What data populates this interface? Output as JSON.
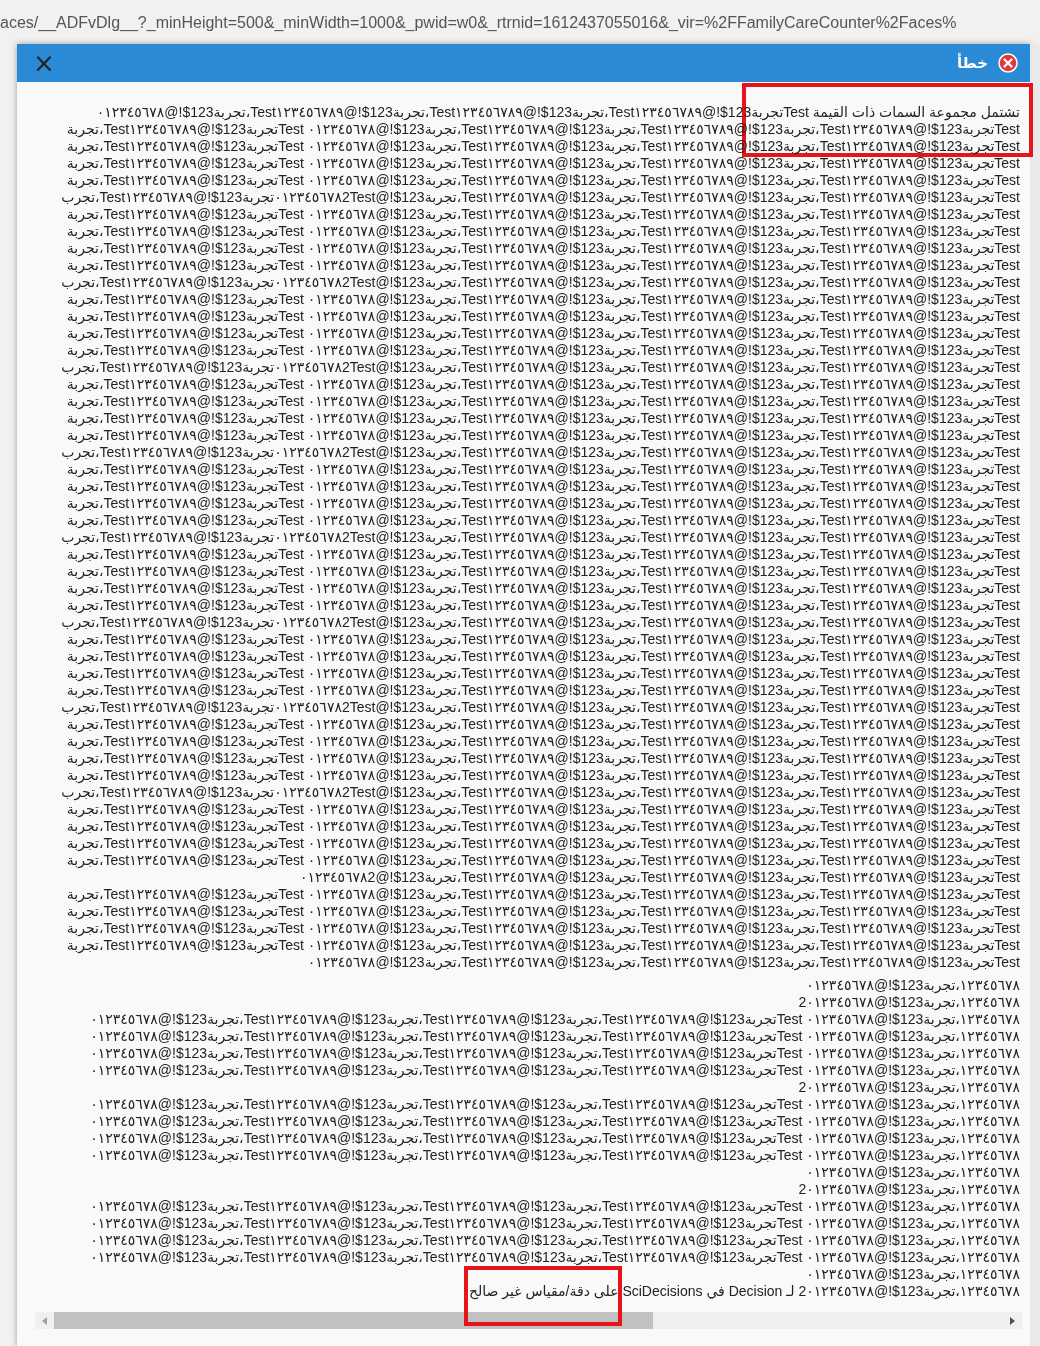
{
  "browser": {
    "address": "aces/__ADFvDlg__?_minHeight=500&_minWidth=1000&_pwid=w0&_rtrnid=1612437055016&_vir=%2FFamilyCareCounter%2Faces%"
  },
  "dialog": {
    "title": "خطأ",
    "close": "×",
    "message": {
      "lines": [
        "تشتمل مجموعة السمات ذات القيمة Testتجربة123$!@Test١٢٣٤٥٦٧٨٩،تجربة123$!@Test١٢٣٤٥٦٧٨٩،تجربة123$!@Test١٢٣٤٥٦٧٨٩،تجربة123$!@٠١٢٣٤٥٦٧٨",
        "Testتجربة123$!@Test١٢٣٤٥٦٧٨٩،تجربة123$!@Test١٢٣٤٥٦٧٨٩،تجربة123$!@Test١٢٣٤٥٦٧٨٩،تجربة123$!@٠١٢٣٤٥٦٧٨ Testتجربة123$!@Test١٢٣٤٥٦٧٨٩،تجربة",
        "Testتجربة123$!@Test١٢٣٤٥٦٧٨٩،تجربة123$!@Test١٢٣٤٥٦٧٨٩،تجربة123$!@Test١٢٣٤٥٦٧٨٩،تجربة123$!@٠١٢٣٤٥٦٧٨ Testتجربة123$!@Test١٢٣٤٥٦٧٨٩،تجربة",
        "Testتجربة123$!@Test١٢٣٤٥٦٧٨٩،تجربة123$!@Test١٢٣٤٥٦٧٨٩،تجربة123$!@Test١٢٣٤٥٦٧٨٩،تجربة123$!@٠١٢٣٤٥٦٧٨ Testتجربة123$!@Test١٢٣٤٥٦٧٨٩،تجربة",
        "Testتجربة123$!@Test١٢٣٤٥٦٧٨٩،تجربة123$!@Test١٢٣٤٥٦٧٨٩،تجربة123$!@Test١٢٣٤٥٦٧٨٩،تجربة123$!@٠١٢٣٤٥٦٧٨ Testتجربة123$!@Test١٢٣٤٥٦٧٨٩،تجربة",
        "Testتجربة123$!@Test١٢٣٤٥٦٧٨٩،تجربة123$!@Test١٢٣٤٥٦٧٨٩،تجربة123$!@Test١٢٣٤٥٦٧٨٩،تجربة123$!@٠١٢٣٤٥٦٧٨2Testتجربة123$!@Test١٢٣٤٥٦٧٨٩،تجرب",
        "Testتجربة123$!@Test١٢٣٤٥٦٧٨٩،تجربة123$!@Test١٢٣٤٥٦٧٨٩،تجربة123$!@Test١٢٣٤٥٦٧٨٩،تجربة123$!@٠١٢٣٤٥٦٧٨ Testتجربة123$!@Test١٢٣٤٥٦٧٨٩،تجربة",
        "Testتجربة123$!@Test١٢٣٤٥٦٧٨٩،تجربة123$!@Test١٢٣٤٥٦٧٨٩،تجربة123$!@Test١٢٣٤٥٦٧٨٩،تجربة123$!@٠١٢٣٤٥٦٧٨ Testتجربة123$!@Test١٢٣٤٥٦٧٨٩،تجربة",
        "Testتجربة123$!@Test١٢٣٤٥٦٧٨٩،تجربة123$!@Test١٢٣٤٥٦٧٨٩،تجربة123$!@Test١٢٣٤٥٦٧٨٩،تجربة123$!@٠١٢٣٤٥٦٧٨ Testتجربة123$!@Test١٢٣٤٥٦٧٨٩،تجربة",
        "Testتجربة123$!@Test١٢٣٤٥٦٧٨٩،تجربة123$!@Test١٢٣٤٥٦٧٨٩،تجربة123$!@Test١٢٣٤٥٦٧٨٩،تجربة123$!@٠١٢٣٤٥٦٧٨ Testتجربة123$!@Test١٢٣٤٥٦٧٨٩،تجربة",
        "Testتجربة123$!@Test١٢٣٤٥٦٧٨٩،تجربة123$!@Test١٢٣٤٥٦٧٨٩،تجربة123$!@Test١٢٣٤٥٦٧٨٩،تجربة123$!@٠١٢٣٤٥٦٧٨2Testتجربة123$!@Test١٢٣٤٥٦٧٨٩،تجرب",
        "Testتجربة123$!@Test١٢٣٤٥٦٧٨٩،تجربة123$!@Test١٢٣٤٥٦٧٨٩،تجربة123$!@Test١٢٣٤٥٦٧٨٩،تجربة123$!@٠١٢٣٤٥٦٧٨ Testتجربة123$!@Test١٢٣٤٥٦٧٨٩،تجربة",
        "Testتجربة123$!@Test١٢٣٤٥٦٧٨٩،تجربة123$!@Test١٢٣٤٥٦٧٨٩،تجربة123$!@Test١٢٣٤٥٦٧٨٩،تجربة123$!@٠١٢٣٤٥٦٧٨ Testتجربة123$!@Test١٢٣٤٥٦٧٨٩،تجربة",
        "Testتجربة123$!@Test١٢٣٤٥٦٧٨٩،تجربة123$!@Test١٢٣٤٥٦٧٨٩،تجربة123$!@Test١٢٣٤٥٦٧٨٩،تجربة123$!@٠١٢٣٤٥٦٧٨ Testتجربة123$!@Test١٢٣٤٥٦٧٨٩،تجربة",
        "Testتجربة123$!@Test١٢٣٤٥٦٧٨٩،تجربة123$!@Test١٢٣٤٥٦٧٨٩،تجربة123$!@Test١٢٣٤٥٦٧٨٩،تجربة123$!@٠١٢٣٤٥٦٧٨ Testتجربة123$!@Test١٢٣٤٥٦٧٨٩،تجربة",
        "Testتجربة123$!@Test١٢٣٤٥٦٧٨٩،تجربة123$!@Test١٢٣٤٥٦٧٨٩،تجربة123$!@Test١٢٣٤٥٦٧٨٩،تجربة123$!@٠١٢٣٤٥٦٧٨2Testتجربة123$!@Test١٢٣٤٥٦٧٨٩،تجرب",
        "Testتجربة123$!@Test١٢٣٤٥٦٧٨٩،تجربة123$!@Test١٢٣٤٥٦٧٨٩،تجربة123$!@Test١٢٣٤٥٦٧٨٩،تجربة123$!@٠١٢٣٤٥٦٧٨ Testتجربة123$!@Test١٢٣٤٥٦٧٨٩،تجربة",
        "Testتجربة123$!@Test١٢٣٤٥٦٧٨٩،تجربة123$!@Test١٢٣٤٥٦٧٨٩،تجربة123$!@Test١٢٣٤٥٦٧٨٩،تجربة123$!@٠١٢٣٤٥٦٧٨ Testتجربة123$!@Test١٢٣٤٥٦٧٨٩،تجربة",
        "Testتجربة123$!@Test١٢٣٤٥٦٧٨٩،تجربة123$!@Test١٢٣٤٥٦٧٨٩،تجربة123$!@Test١٢٣٤٥٦٧٨٩،تجربة123$!@٠١٢٣٤٥٦٧٨ Testتجربة123$!@Test١٢٣٤٥٦٧٨٩،تجربة",
        "Testتجربة123$!@Test١٢٣٤٥٦٧٨٩،تجربة123$!@Test١٢٣٤٥٦٧٨٩،تجربة123$!@Test١٢٣٤٥٦٧٨٩،تجربة123$!@٠١٢٣٤٥٦٧٨ Testتجربة123$!@Test١٢٣٤٥٦٧٨٩،تجربة",
        "Testتجربة123$!@Test١٢٣٤٥٦٧٨٩،تجربة123$!@Test١٢٣٤٥٦٧٨٩،تجربة123$!@Test١٢٣٤٥٦٧٨٩،تجربة123$!@٠١٢٣٤٥٦٧٨2Testتجربة123$!@Test١٢٣٤٥٦٧٨٩،تجرب",
        "Testتجربة123$!@Test١٢٣٤٥٦٧٨٩،تجربة123$!@Test١٢٣٤٥٦٧٨٩،تجربة123$!@Test١٢٣٤٥٦٧٨٩،تجربة123$!@٠١٢٣٤٥٦٧٨ Testتجربة123$!@Test١٢٣٤٥٦٧٨٩،تجربة",
        "Testتجربة123$!@Test١٢٣٤٥٦٧٨٩،تجربة123$!@Test١٢٣٤٥٦٧٨٩،تجربة123$!@Test١٢٣٤٥٦٧٨٩،تجربة123$!@٠١٢٣٤٥٦٧٨ Testتجربة123$!@Test١٢٣٤٥٦٧٨٩،تجربة",
        "Testتجربة123$!@Test١٢٣٤٥٦٧٨٩،تجربة123$!@Test١٢٣٤٥٦٧٨٩،تجربة123$!@Test١٢٣٤٥٦٧٨٩،تجربة123$!@٠١٢٣٤٥٦٧٨ Testتجربة123$!@Test١٢٣٤٥٦٧٨٩،تجربة",
        "Testتجربة123$!@Test١٢٣٤٥٦٧٨٩،تجربة123$!@Test١٢٣٤٥٦٧٨٩،تجربة123$!@Test١٢٣٤٥٦٧٨٩،تجربة123$!@٠١٢٣٤٥٦٧٨ Testتجربة123$!@Test١٢٣٤٥٦٧٨٩،تجربة",
        "Testتجربة123$!@Test١٢٣٤٥٦٧٨٩،تجربة123$!@Test١٢٣٤٥٦٧٨٩،تجربة123$!@Test١٢٣٤٥٦٧٨٩،تجربة123$!@٠١٢٣٤٥٦٧٨2Testتجربة123$!@Test١٢٣٤٥٦٧٨٩،تجرب",
        "Testتجربة123$!@Test١٢٣٤٥٦٧٨٩،تجربة123$!@Test١٢٣٤٥٦٧٨٩،تجربة123$!@Test١٢٣٤٥٦٧٨٩،تجربة123$!@٠١٢٣٤٥٦٧٨ Testتجربة123$!@Test١٢٣٤٥٦٧٨٩،تجربة",
        "Testتجربة123$!@Test١٢٣٤٥٦٧٨٩،تجربة123$!@Test١٢٣٤٥٦٧٨٩،تجربة123$!@Test١٢٣٤٥٦٧٨٩،تجربة123$!@٠١٢٣٤٥٦٧٨ Testتجربة123$!@Test١٢٣٤٥٦٧٨٩،تجربة",
        "Testتجربة123$!@Test١٢٣٤٥٦٧٨٩،تجربة123$!@Test١٢٣٤٥٦٧٨٩،تجربة123$!@Test١٢٣٤٥٦٧٨٩،تجربة123$!@٠١٢٣٤٥٦٧٨ Testتجربة123$!@Test١٢٣٤٥٦٧٨٩،تجربة",
        "Testتجربة123$!@Test١٢٣٤٥٦٧٨٩،تجربة123$!@Test١٢٣٤٥٦٧٨٩،تجربة123$!@Test١٢٣٤٥٦٧٨٩،تجربة123$!@٠١٢٣٤٥٦٧٨ Testتجربة123$!@Test١٢٣٤٥٦٧٨٩،تجربة",
        "Testتجربة123$!@Test١٢٣٤٥٦٧٨٩،تجربة123$!@Test١٢٣٤٥٦٧٨٩،تجربة123$!@Test١٢٣٤٥٦٧٨٩،تجربة123$!@٠١٢٣٤٥٦٧٨2Testتجربة123$!@Test١٢٣٤٥٦٧٨٩،تجرب",
        "Testتجربة123$!@Test١٢٣٤٥٦٧٨٩،تجربة123$!@Test١٢٣٤٥٦٧٨٩،تجربة123$!@Test١٢٣٤٥٦٧٨٩،تجربة123$!@٠١٢٣٤٥٦٧٨ Testتجربة123$!@Test١٢٣٤٥٦٧٨٩،تجربة",
        "Testتجربة123$!@Test١٢٣٤٥٦٧٨٩،تجربة123$!@Test١٢٣٤٥٦٧٨٩،تجربة123$!@Test١٢٣٤٥٦٧٨٩،تجربة123$!@٠١٢٣٤٥٦٧٨ Testتجربة123$!@Test١٢٣٤٥٦٧٨٩،تجربة",
        "Testتجربة123$!@Test١٢٣٤٥٦٧٨٩،تجربة123$!@Test١٢٣٤٥٦٧٨٩،تجربة123$!@Test١٢٣٤٥٦٧٨٩،تجربة123$!@٠١٢٣٤٥٦٧٨ Testتجربة123$!@Test١٢٣٤٥٦٧٨٩،تجربة",
        "Testتجربة123$!@Test١٢٣٤٥٦٧٨٩،تجربة123$!@Test١٢٣٤٥٦٧٨٩،تجربة123$!@Test١٢٣٤٥٦٧٨٩،تجربة123$!@٠١٢٣٤٥٦٧٨ Testتجربة123$!@Test١٢٣٤٥٦٧٨٩،تجربة",
        "Testتجربة123$!@Test١٢٣٤٥٦٧٨٩،تجربة123$!@Test١٢٣٤٥٦٧٨٩،تجربة123$!@Test١٢٣٤٥٦٧٨٩،تجربة123$!@٠١٢٣٤٥٦٧٨2Testتجربة123$!@Test١٢٣٤٥٦٧٨٩،تجرب",
        "Testتجربة123$!@Test١٢٣٤٥٦٧٨٩،تجربة123$!@Test١٢٣٤٥٦٧٨٩،تجربة123$!@Test١٢٣٤٥٦٧٨٩،تجربة123$!@٠١٢٣٤٥٦٧٨ Testتجربة123$!@Test١٢٣٤٥٦٧٨٩،تجربة",
        "Testتجربة123$!@Test١٢٣٤٥٦٧٨٩،تجربة123$!@Test١٢٣٤٥٦٧٨٩،تجربة123$!@Test١٢٣٤٥٦٧٨٩،تجربة123$!@٠١٢٣٤٥٦٧٨ Testتجربة123$!@Test١٢٣٤٥٦٧٨٩،تجربة",
        "Testتجربة123$!@Test١٢٣٤٥٦٧٨٩،تجربة123$!@Test١٢٣٤٥٦٧٨٩،تجربة123$!@Test١٢٣٤٥٦٧٨٩،تجربة123$!@٠١٢٣٤٥٦٧٨ Testتجربة123$!@Test١٢٣٤٥٦٧٨٩،تجربة",
        "Testتجربة123$!@Test١٢٣٤٥٦٧٨٩،تجربة123$!@Test١٢٣٤٥٦٧٨٩،تجربة123$!@Test١٢٣٤٥٦٧٨٩،تجربة123$!@٠١٢٣٤٥٦٧٨ Testتجربة123$!@Test١٢٣٤٥٦٧٨٩،تجربة",
        "Testتجربة123$!@Test١٢٣٤٥٦٧٨٩،تجربة123$!@Test١٢٣٤٥٦٧٨٩،تجربة123$!@Test١٢٣٤٥٦٧٨٩،تجربة123$!@٠١٢٣٤٥٦٧٨2Testتجربة123$!@Test١٢٣٤٥٦٧٨٩،تجرب",
        "Testتجربة123$!@Test١٢٣٤٥٦٧٨٩،تجربة123$!@Test١٢٣٤٥٦٧٨٩،تجربة123$!@Test١٢٣٤٥٦٧٨٩،تجربة123$!@٠١٢٣٤٥٦٧٨ Testتجربة123$!@Test١٢٣٤٥٦٧٨٩،تجربة",
        "Testتجربة123$!@Test١٢٣٤٥٦٧٨٩،تجربة123$!@Test١٢٣٤٥٦٧٨٩،تجربة123$!@Test١٢٣٤٥٦٧٨٩،تجربة123$!@٠١٢٣٤٥٦٧٨ Testتجربة123$!@Test١٢٣٤٥٦٧٨٩،تجربة",
        "Testتجربة123$!@Test١٢٣٤٥٦٧٨٩،تجربة123$!@Test١٢٣٤٥٦٧٨٩،تجربة123$!@Test١٢٣٤٥٦٧٨٩،تجربة123$!@٠١٢٣٤٥٦٧٨ Testتجربة123$!@Test١٢٣٤٥٦٧٨٩،تجربة",
        "Testتجربة123$!@Test١٢٣٤٥٦٧٨٩،تجربة123$!@Test١٢٣٤٥٦٧٨٩،تجربة123$!@Test١٢٣٤٥٦٧٨٩،تجربة123$!@٠١٢٣٤٥٦٧٨ Testتجربة123$!@Test١٢٣٤٥٦٧٨٩،تجربة",
        "Testتجربة123$!@Test١٢٣٤٥٦٧٨٩،تجربة123$!@Test١٢٣٤٥٦٧٨٩،تجربة123$!@Test١٢٣٤٥٦٧٨٩،تجربة123$!@٠١٢٣٤٥٦٧٨2",
        "Testتجربة123$!@Test١٢٣٤٥٦٧٨٩،تجربة123$!@Test١٢٣٤٥٦٧٨٩،تجربة123$!@Test١٢٣٤٥٦٧٨٩،تجربة123$!@٠١٢٣٤٥٦٧٨ Testتجربة123$!@Test١٢٣٤٥٦٧٨٩،تجربة",
        "Testتجربة123$!@Test١٢٣٤٥٦٧٨٩،تجربة123$!@Test١٢٣٤٥٦٧٨٩،تجربة123$!@Test١٢٣٤٥٦٧٨٩،تجربة123$!@٠١٢٣٤٥٦٧٨ Testتجربة123$!@Test١٢٣٤٥٦٧٨٩،تجربة",
        "Testتجربة123$!@Test١٢٣٤٥٦٧٨٩،تجربة123$!@Test١٢٣٤٥٦٧٨٩،تجربة123$!@Test١٢٣٤٥٦٧٨٩،تجربة123$!@٠١٢٣٤٥٦٧٨ Testتجربة123$!@Test١٢٣٤٥٦٧٨٩،تجربة",
        "Testتجربة123$!@Test١٢٣٤٥٦٧٨٩،تجربة123$!@Test١٢٣٤٥٦٧٨٩،تجربة123$!@Test١٢٣٤٥٦٧٨٩،تجربة123$!@٠١٢٣٤٥٦٧٨ Testتجربة123$!@Test١٢٣٤٥٦٧٨٩،تجربة",
        "Testتجربة123$!@Test١٢٣٤٥٦٧٨٩،تجربة123$!@Test١٢٣٤٥٦٧٨٩،تجربة123$!@Test١٢٣٤٥٦٧٨٩،تجربة123$!@٠١٢٣٤٥٦٧٨"
      ]
    },
    "details": {
      "lines": [
        "١٢٣٤٥٦٧٨،تجربة123$!@٠١٢٣٤٥٦٧٨",
        "١٢٣٤٥٦٧٨،تجربة123$!@2٠١٢٣٤٥٦٧٨",
        "١٢٣٤٥٦٧٨،تجربة123$!@٠١٢٣٤٥٦٧٨ Testتجربة123$!@Test١٢٣٤٥٦٧٨٩،تجربة123$!@Test١٢٣٤٥٦٧٨٩،تجربة123$!@Test١٢٣٤٥٦٧٨٩،تجربة123$!@٠١٢٣٤٥٦٧٨",
        "١٢٣٤٥٦٧٨،تجربة123$!@٠١٢٣٤٥٦٧٨ Testتجربة123$!@Test١٢٣٤٥٦٧٨٩،تجربة123$!@Test١٢٣٤٥٦٧٨٩،تجربة123$!@Test١٢٣٤٥٦٧٨٩،تجربة123$!@٠١٢٣٤٥٦٧٨",
        "١٢٣٤٥٦٧٨،تجربة123$!@٠١٢٣٤٥٦٧٨ Testتجربة123$!@Test١٢٣٤٥٦٧٨٩،تجربة123$!@Test١٢٣٤٥٦٧٨٩،تجربة123$!@Test١٢٣٤٥٦٧٨٩،تجربة123$!@٠١٢٣٤٥٦٧٨",
        "١٢٣٤٥٦٧٨،تجربة123$!@٠١٢٣٤٥٦٧٨ Testتجربة123$!@Test١٢٣٤٥٦٧٨٩،تجربة123$!@Test١٢٣٤٥٦٧٨٩،تجربة123$!@Test١٢٣٤٥٦٧٨٩،تجربة123$!@٠١٢٣٤٥٦٧٨",
        "١٢٣٤٥٦٧٨،تجربة123$!@2٠١٢٣٤٥٦٧٨",
        "١٢٣٤٥٦٧٨،تجربة123$!@٠١٢٣٤٥٦٧٨ Testتجربة123$!@Test١٢٣٤٥٦٧٨٩،تجربة123$!@Test١٢٣٤٥٦٧٨٩،تجربة123$!@Test١٢٣٤٥٦٧٨٩،تجربة123$!@٠١٢٣٤٥٦٧٨",
        "١٢٣٤٥٦٧٨،تجربة123$!@٠١٢٣٤٥٦٧٨ Testتجربة123$!@Test١٢٣٤٥٦٧٨٩،تجربة123$!@Test١٢٣٤٥٦٧٨٩،تجربة123$!@Test١٢٣٤٥٦٧٨٩،تجربة123$!@٠١٢٣٤٥٦٧٨",
        "١٢٣٤٥٦٧٨،تجربة123$!@٠١٢٣٤٥٦٧٨ Testتجربة123$!@Test١٢٣٤٥٦٧٨٩،تجربة123$!@Test١٢٣٤٥٦٧٨٩،تجربة123$!@Test١٢٣٤٥٦٧٨٩،تجربة123$!@٠١٢٣٤٥٦٧٨",
        "١٢٣٤٥٦٧٨،تجربة123$!@٠١٢٣٤٥٦٧٨ Testتجربة123$!@Test١٢٣٤٥٦٧٨٩،تجربة123$!@Test١٢٣٤٥٦٧٨٩،تجربة123$!@Test١٢٣٤٥٦٧٨٩،تجربة123$!@٠١٢٣٤٥٦٧٨",
        "١٢٣٤٥٦٧٨،تجربة123$!@٠١٢٣٤٥٦٧٨",
        "١٢٣٤٥٦٧٨،تجربة123$!@2٠١٢٣٤٥٦٧٨",
        "١٢٣٤٥٦٧٨،تجربة123$!@٠١٢٣٤٥٦٧٨ Testتجربة123$!@Test١٢٣٤٥٦٧٨٩،تجربة123$!@Test١٢٣٤٥٦٧٨٩،تجربة123$!@Test١٢٣٤٥٦٧٨٩،تجربة123$!@٠١٢٣٤٥٦٧٨",
        "١٢٣٤٥٦٧٨،تجربة123$!@٠١٢٣٤٥٦٧٨ Testتجربة123$!@Test١٢٣٤٥٦٧٨٩،تجربة123$!@Test١٢٣٤٥٦٧٨٩،تجربة123$!@Test١٢٣٤٥٦٧٨٩،تجربة123$!@٠١٢٣٤٥٦٧٨",
        "١٢٣٤٥٦٧٨،تجربة123$!@٠١٢٣٤٥٦٧٨ Testتجربة123$!@Test١٢٣٤٥٦٧٨٩،تجربة123$!@Test١٢٣٤٥٦٧٨٩،تجربة123$!@Test١٢٣٤٥٦٧٨٩،تجربة123$!@٠١٢٣٤٥٦٧٨",
        "١٢٣٤٥٦٧٨،تجربة123$!@٠١٢٣٤٥٦٧٨ Testتجربة123$!@Test١٢٣٤٥٦٧٨٩،تجربة123$!@Test١٢٣٤٥٦٧٨٩،تجربة123$!@Test١٢٣٤٥٦٧٨٩،تجربة123$!@٠١٢٣٤٥٦٧٨",
        "١٢٣٤٥٦٧٨،تجربة123$!@٠١٢٣٤٥٦٧٨",
        "١٢٣٤٥٦٧٨،تجربة123$!@2٠١٢٣٤٥٦٧٨ لـ Decision في SciDecisions على دقة/مقياس غير صالح"
      ]
    }
  }
}
